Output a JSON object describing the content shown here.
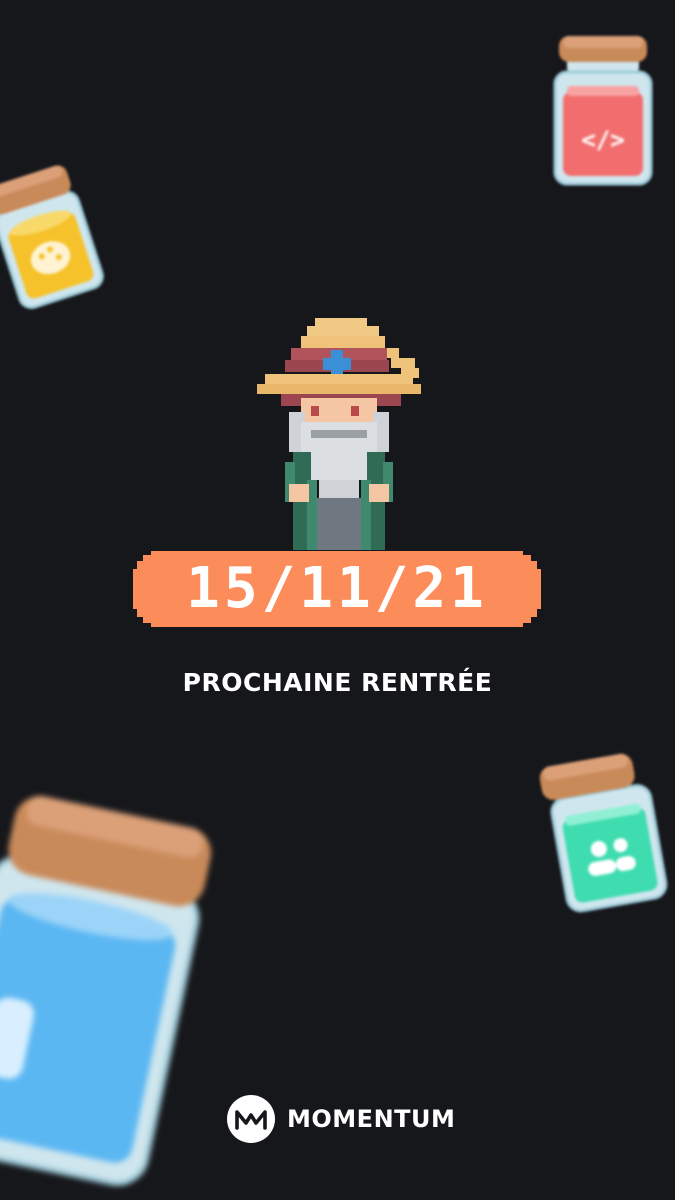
{
  "event": {
    "date": "15/11/21",
    "caption": "PROCHAINE RENTRÉE"
  },
  "brand": {
    "name": "MOMENTUM",
    "logo_icon": "momentum-logo-icon"
  },
  "decorations": {
    "jars": [
      {
        "name": "code-jar",
        "icon": "code-icon",
        "color": "#f56d6d"
      },
      {
        "name": "palette-jar",
        "icon": "palette-icon",
        "color": "#f6c22b"
      },
      {
        "name": "people-jar",
        "icon": "people-icon",
        "color": "#3fdcb0"
      },
      {
        "name": "blue-jar",
        "icon": "blue-jar-icon",
        "color": "#5bb7f2"
      }
    ],
    "character": "wizard-character"
  },
  "colors": {
    "background": "#16171b",
    "accent": "#fc8c5a",
    "text": "#ffffff"
  }
}
